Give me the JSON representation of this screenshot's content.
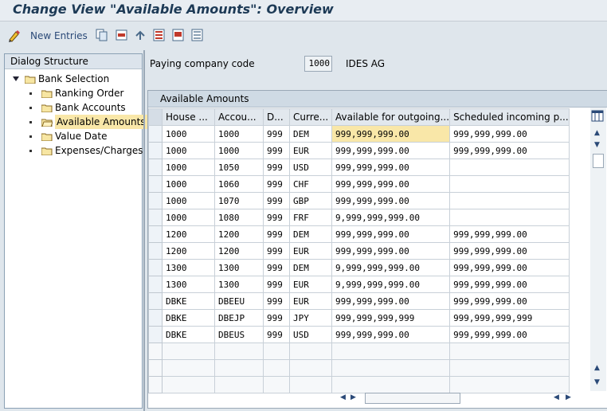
{
  "title": "Change View \"Available Amounts\": Overview",
  "toolbar": {
    "new_entries": "New Entries"
  },
  "dialog": {
    "header": "Dialog Structure",
    "items": [
      {
        "label": "Bank Selection",
        "level": 0
      },
      {
        "label": "Ranking Order",
        "level": 1
      },
      {
        "label": "Bank Accounts",
        "level": 1
      },
      {
        "label": "Available Amounts",
        "level": 1,
        "selected": true
      },
      {
        "label": "Value Date",
        "level": 1
      },
      {
        "label": "Expenses/Charges",
        "level": 1
      }
    ]
  },
  "form": {
    "paying_company_label": "Paying company code",
    "paying_company_value": "1000",
    "company_name": "IDES AG"
  },
  "table": {
    "title": "Available Amounts",
    "columns": [
      "House ...",
      "Accou...",
      "D...",
      "Curre...",
      "Available for outgoing...",
      "Scheduled incoming p..."
    ],
    "rows": [
      [
        "1000",
        "1000",
        "999",
        "DEM",
        "999,999,999.00",
        "999,999,999.00"
      ],
      [
        "1000",
        "1000",
        "999",
        "EUR",
        "999,999,999.00",
        "999,999,999.00"
      ],
      [
        "1000",
        "1050",
        "999",
        "USD",
        "999,999,999.00",
        ""
      ],
      [
        "1000",
        "1060",
        "999",
        "CHF",
        "999,999,999.00",
        ""
      ],
      [
        "1000",
        "1070",
        "999",
        "GBP",
        "999,999,999.00",
        ""
      ],
      [
        "1000",
        "1080",
        "999",
        "FRF",
        "9,999,999,999.00",
        ""
      ],
      [
        "1200",
        "1200",
        "999",
        "DEM",
        "999,999,999.00",
        "999,999,999.00"
      ],
      [
        "1200",
        "1200",
        "999",
        "EUR",
        "999,999,999.00",
        "999,999,999.00"
      ],
      [
        "1300",
        "1300",
        "999",
        "DEM",
        "9,999,999,999.00",
        "999,999,999.00"
      ],
      [
        "1300",
        "1300",
        "999",
        "EUR",
        "9,999,999,999.00",
        "999,999,999.00"
      ],
      [
        "DBKE",
        "DBEEU",
        "999",
        "EUR",
        "999,999,999.00",
        "999,999,999.00"
      ],
      [
        "DBKE",
        "DBEJP",
        "999",
        "JPY",
        "999,999,999,999",
        "999,999,999,999"
      ],
      [
        "DBKE",
        "DBEUS",
        "999",
        "USD",
        "999,999,999.00",
        "999,999,999.00"
      ]
    ],
    "empty_rows": 3
  }
}
